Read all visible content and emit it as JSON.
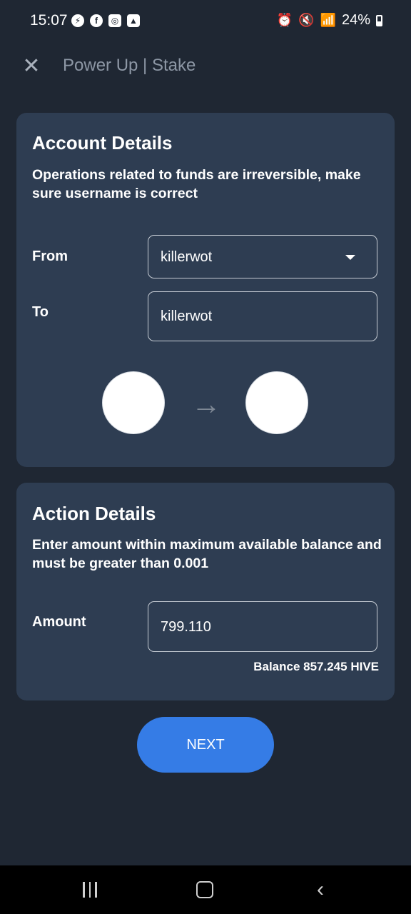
{
  "status_bar": {
    "time": "15:07",
    "left_icons": [
      "messenger-icon",
      "facebook-icon",
      "instagram-icon",
      "gallery-icon"
    ],
    "right_icons": [
      "alarm-icon",
      "mute-icon",
      "wifi-icon",
      "signal-icon"
    ],
    "battery_percent": "24%"
  },
  "header": {
    "close_glyph": "✕",
    "title": "Power Up | Stake"
  },
  "account_card": {
    "title": "Account Details",
    "subtitle": "Operations related to funds are irreversible, make sure username is correct",
    "from_label": "From",
    "from_value": "killerwot",
    "to_label": "To",
    "to_value": "killerwot",
    "arrow_glyph": "→"
  },
  "action_card": {
    "title": "Action Details",
    "subtitle": "Enter amount within maximum available balance and must be greater than 0.001",
    "amount_label": "Amount",
    "amount_value": "799.110",
    "balance": "Balance 857.245 HIVE"
  },
  "next_button": {
    "label": "NEXT"
  },
  "colors": {
    "background": "#1f2733",
    "card": "#2e3d52",
    "accent": "#357ce6"
  },
  "nav_bar": {
    "back_glyph": "‹"
  }
}
